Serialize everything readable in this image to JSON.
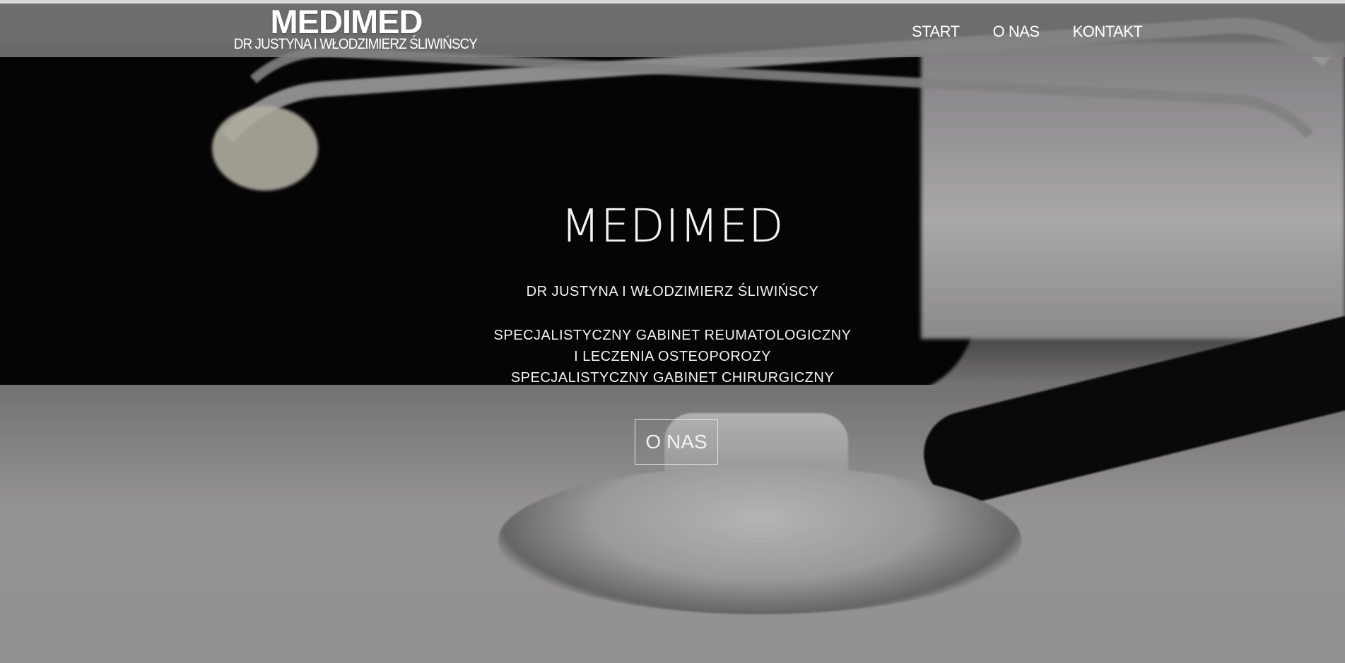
{
  "brand": {
    "title": "MEDIMED",
    "subtitle": "DR JUSTYNA I WŁODZIMIERZ ŚLIWIŃSCY"
  },
  "nav": {
    "items": [
      {
        "label": "START"
      },
      {
        "label": "O NAS"
      },
      {
        "label": "KONTAKT"
      }
    ]
  },
  "hero": {
    "title": "MEDIMED",
    "doctors": "DR JUSTYNA I WŁODZIMIERZ ŚLIWIŃSCY",
    "lines": [
      "SPECJALISTYCZNY GABINET REUMATOLOGICZNY",
      "I LECZENIA OSTEOPOROZY",
      "SPECJALISTYCZNY GABINET CHIRURGICZNY"
    ],
    "button_label": "O NAS"
  },
  "colors": {
    "navbar_bg": "#808080",
    "text": "#ffffff",
    "button_border": "#e6e6e6"
  }
}
